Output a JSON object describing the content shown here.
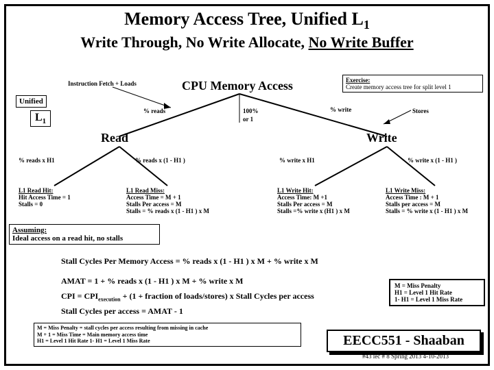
{
  "title_main": "Memory Access Tree, Unified L",
  "title_sub": "1",
  "subtitle_a": "Write Through, No Write Allocate, ",
  "subtitle_b": "No Write Buffer",
  "top_label": "Instruction Fetch + Loads",
  "cpu_mem": "CPU Memory  Access",
  "exercise_hdr": "Exercise:",
  "exercise_body": "Create memory access tree for split level 1",
  "unified_box": "Unified",
  "l1_box": "L",
  "l1_sub": "1",
  "pct_reads": "% reads",
  "pct_write": "% write",
  "stores": "Stores",
  "read_lbl": "Read",
  "write_lbl": "Write",
  "hundred": "100%",
  "or1": "or 1",
  "rx_h1": "% reads x  H1",
  "rx_1mh1": "% reads x (1  -  H1 )",
  "wx_h1": "% write x  H1",
  "wx_1mh1": "% write  x  (1 -  H1 )",
  "l1rh_hdr": "L1 Read  Hit:",
  "l1rh_1": "Hit Access Time = 1",
  "l1rh_2": "Stalls = 0",
  "l1rm_hdr": "L1  Read  Miss:",
  "l1rm_1": "Access Time  =  M  +  1",
  "l1rm_2": "Stalls Per access = M",
  "l1rm_3": "Stalls = % reads x (1  - H1 ) x M",
  "l1wh_hdr": "L1 Write Hit:",
  "l1wh_1": "Access Time:   M +1",
  "l1wh_2": "Stalls Per access = M",
  "l1wh_3": "Stalls =% write x  (H1 ) x M",
  "l1wm_hdr": "L1  Write Miss:",
  "l1wm_1": "Access Time :   M + 1",
  "l1wm_2": "Stalls per access = M",
  "l1wm_3": "Stalls =  % write x  (1 - H1 ) x M",
  "assume_hdr": "Assuming:",
  "assume_body": "Ideal access on a read hit, no stalls",
  "eq1": "Stall Cycles Per Memory Access =    % reads x (1  - H1  ) x M   +  % write  x  M",
  "eq2": "AMAT =   1 +  % reads x (1  -  H1  ) x M    + % write  x M",
  "eq3a": "CPI = CPI",
  "eq3sub": "execution",
  "eq3b": "  +  (1   + fraction of loads/stores) x Stall Cycles per access",
  "eq4": "Stall Cycles per access =   AMAT - 1",
  "legend_m": "M  =  Miss Penalty",
  "legend_h1": "H1  = Level 1  Hit Rate",
  "legend_1mh1": "1- H1 = Level 1 Miss Rate",
  "foot_m": "M   =  Miss Penalty = stall cycles per access resulting from missing in cache",
  "foot_m1": "M + 1  =  Miss Time  = Main memory access time",
  "foot_h1": "H1  =  Level 1  Hit Rate          1- H1 = Level 1 Miss Rate",
  "course": "EECC551 - Shaaban",
  "date": "#43  lec # 8    Spring 2013  4-10-2013"
}
